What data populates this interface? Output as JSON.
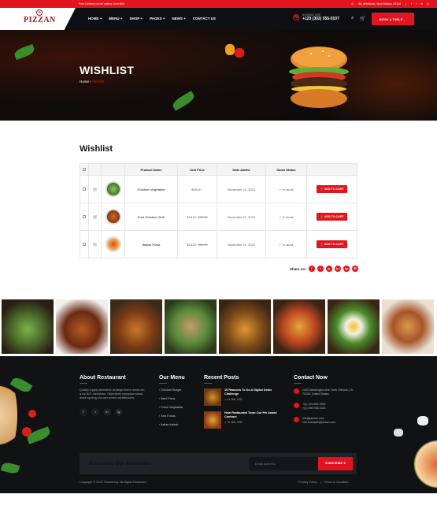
{
  "colors": {
    "accent": "#e3141e",
    "dark": "#0d0f12"
  },
  "topbar": {
    "promo": "Free Delivery on all orders Over $50",
    "address": "66, Allentown, New Mexico 25124",
    "social_icons": [
      "facebook-icon",
      "twitter-icon",
      "linkedin-icon",
      "instagram-icon"
    ]
  },
  "logo": {
    "text": "PIZZAN"
  },
  "nav": {
    "items": [
      "HOME +",
      "MENU +",
      "SHOP +",
      "PAGES +",
      "NEWS +",
      "CONTACT US"
    ]
  },
  "phone": {
    "label": "BOOKING LINE",
    "number": "+123 (302) 555-0107"
  },
  "header": {
    "book_label": "BOOK A TABLE →"
  },
  "hero": {
    "title": "WISHLIST",
    "crumb_home": "Home",
    "crumb_sep": "›",
    "crumb_current": "Wishlist"
  },
  "wishlist": {
    "heading": "Wishlist",
    "columns": [
      "",
      "",
      "",
      "Product Name",
      "Unit Price",
      "Date Added",
      "Stock Status",
      ""
    ],
    "rows": [
      {
        "name": "Chicken Vegetable",
        "price": "$45.00",
        "old_price": "",
        "date": "November 21, 2021",
        "stock": "✓ In stock",
        "cta": "🛒 ADD TO CART"
      },
      {
        "name": "Fuel Chicken Grill",
        "price": "$18.00",
        "old_price": "$28.00",
        "date": "November 21, 2021",
        "stock": "✓ In stock",
        "cta": "🛒 ADD TO CART"
      },
      {
        "name": "Italian Pizza",
        "price": "$18.00",
        "old_price": "$28.00",
        "date": "November 21, 2021",
        "stock": "✓ In stock",
        "cta": "🛒 ADD TO CART"
      }
    ],
    "share_label": "Share on:",
    "share_icons": [
      "f",
      "t",
      "p",
      "in",
      "ig",
      "✉"
    ]
  },
  "footer": {
    "about": {
      "title": "About Restaurant",
      "text": "Quickly supply alternative strategic theme areas vis-a-vis B2C mindshare. Objectively repurpose stand-alone synergy via user-centric architectures.",
      "socials": [
        "f",
        "t",
        "in",
        "ig"
      ]
    },
    "menu": {
      "title": "Our Menu",
      "items": [
        "Chicken Burger",
        "Beef Pizza",
        "Fresh Vegetable",
        "Sea Foods",
        "Italian Kabab"
      ]
    },
    "posts": {
      "title": "Recent Posts",
      "items": [
        {
          "title": "10 Reasons To Do A Digital Detox Challenge",
          "date": "21 JAN, 2022"
        },
        {
          "title": "How Restaurant Town Our Pie Award Contract",
          "date": "21 JAN, 2022"
        }
      ]
    },
    "contact": {
      "title": "Contact Now",
      "address": "1403 Washington Ave, New Orleans, LA 70130, United States",
      "phone1": "+(1) 123 456 7890",
      "phone2": "+(1) 098 765 4321",
      "email1": "info@pizzan.com",
      "email2": "info.example@pizzan.com"
    },
    "newsletter": {
      "title": "Subscribe Our Newsletter",
      "placeholder": "Email Address",
      "button": "SUBSCRIBE ➤"
    },
    "copyright": "Copyright © 2023 Themeholy. All Rights Reserved.",
    "links": [
      "Privacy Policy",
      "|",
      "Terms & Condition"
    ]
  }
}
